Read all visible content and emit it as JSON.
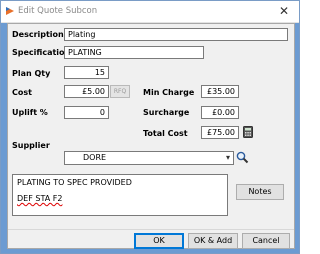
{
  "window": {
    "title": "Edit Quote Subcon",
    "close_icon": "close-icon"
  },
  "form": {
    "description": {
      "label": "Description",
      "value": "Plating"
    },
    "specification": {
      "label": "Specification",
      "value": "PLATING"
    },
    "plan_qty": {
      "label": "Plan Qty",
      "value": "15"
    },
    "cost": {
      "label": "Cost",
      "value": "£5.00",
      "rfq_label": "RFQ"
    },
    "uplift": {
      "label": "Uplift %",
      "value": "0"
    },
    "min_charge": {
      "label": "Min Charge",
      "value": "£35.00"
    },
    "surcharge": {
      "label": "Surcharge",
      "value": "£0.00"
    },
    "total_cost": {
      "label": "Total Cost",
      "value": "£75.00"
    },
    "supplier": {
      "label": "Supplier",
      "value": "DORE"
    }
  },
  "notes": {
    "lines": [
      "PLATING TO SPEC PROVIDED",
      "DEF STA F2"
    ],
    "button_label": "Notes"
  },
  "footer": {
    "ok_label": "OK",
    "ok_add_label": "OK & Add",
    "cancel_label": "Cancel"
  },
  "colors": {
    "accent": "#0078d7",
    "frame": "#6c9bd2"
  }
}
